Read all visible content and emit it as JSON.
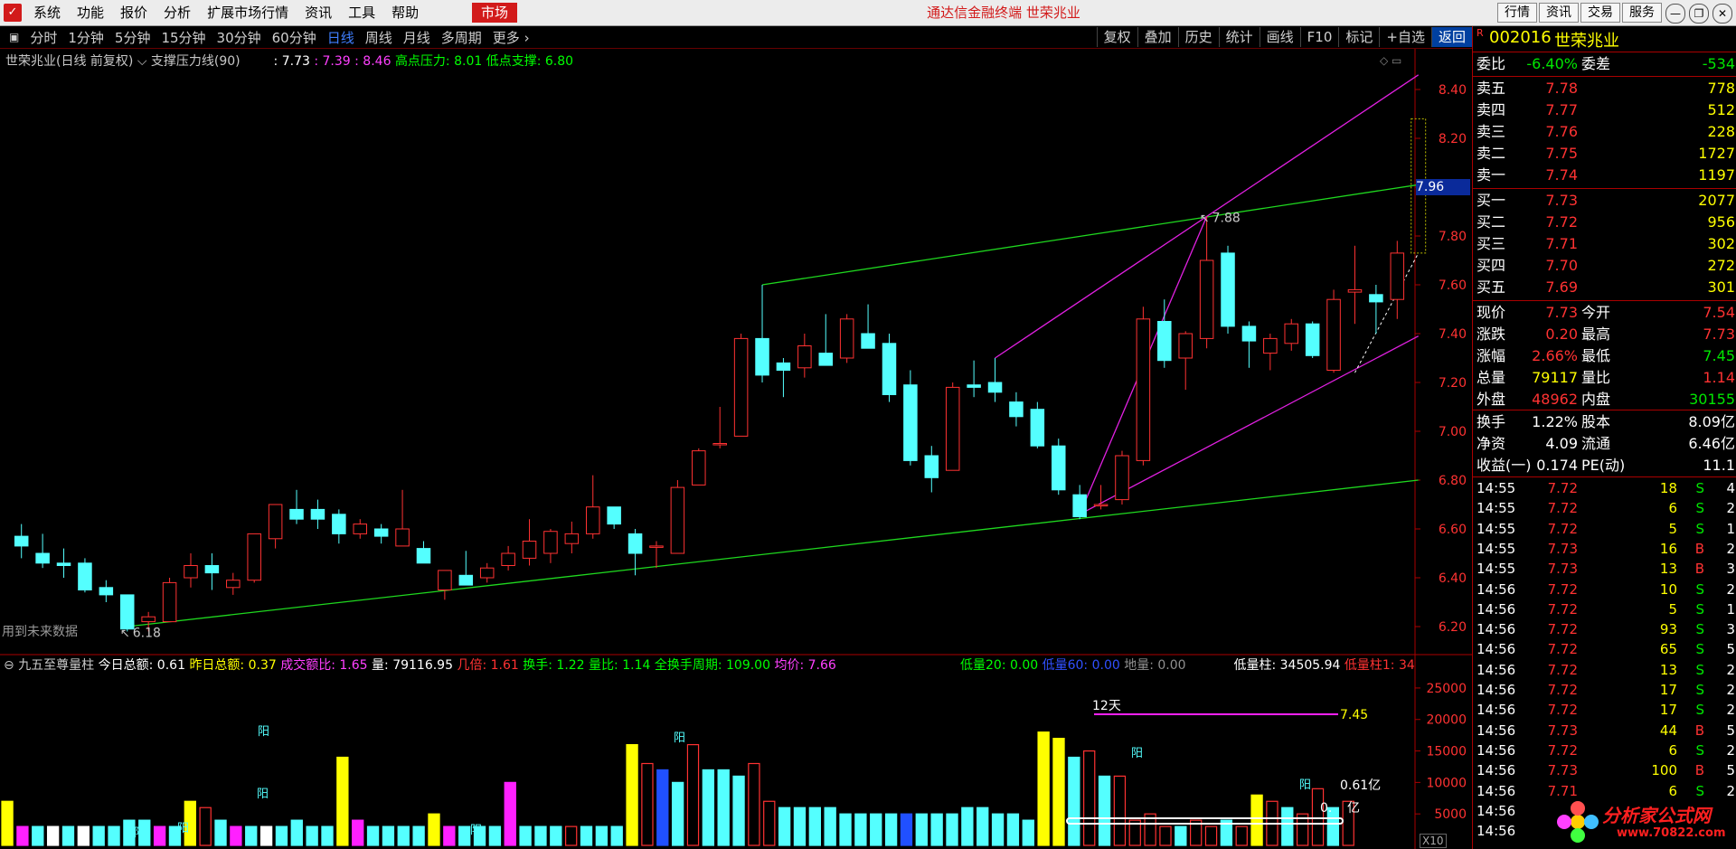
{
  "menubar": {
    "logo": "",
    "items": [
      "系统",
      "功能",
      "报价",
      "分析",
      "扩展市场行情",
      "资讯",
      "工具",
      "帮助"
    ],
    "market": "市场",
    "title": "通达信金融终端  世荣兆业",
    "right_buttons": [
      "行情",
      "资讯",
      "交易",
      "服务"
    ],
    "win_buttons": [
      "—",
      "❐",
      "✕"
    ]
  },
  "toolbar": {
    "periods": [
      "分时",
      "1分钟",
      "5分钟",
      "15分钟",
      "30分钟",
      "60分钟",
      "日线",
      "周线",
      "月线",
      "多周期",
      "更多 ›"
    ],
    "active": "日线",
    "right": [
      "复权",
      "叠加",
      "历史",
      "统计",
      "画线",
      "F10",
      "标记",
      "+自选",
      "返回"
    ]
  },
  "main_chart": {
    "stock_label": "世荣兆业(日线 前复权)",
    "indicator": "支撑压力线(90)",
    "val1": ": 7.73",
    "val2": ": 7.39",
    "val3": ": 8.46",
    "high_label": "高点压力: 8.01",
    "low_label": "低点支撑: 6.80",
    "future_note": "用到未来数据",
    "high_point_label": "7.88",
    "low_point_label": "6.18",
    "current_price_tag": "7.96",
    "y_ticks": [
      "8.40",
      "8.20",
      "8.00",
      "7.80",
      "7.60",
      "7.40",
      "7.20",
      "7.00",
      "6.80",
      "6.60",
      "6.40",
      "6.20"
    ]
  },
  "sub_chart": {
    "name": "九五至尊量柱",
    "today_total": "今日总额: 0.61",
    "yesterday_total": "昨日总额: 0.37",
    "amount_ratio": "成交额比: 1.65",
    "volume": "量: 79116.95",
    "times": "几倍: 1.61",
    "turnover": "换手: 1.22",
    "vol_ratio": "量比: 1.14",
    "full_turnover": "全换手周期: 109.00",
    "avg_price": "均价: 7.66",
    "low20": "低量20: 0.00",
    "low60": "低量60: 0.00",
    "ground": "地量: 0.00",
    "low_col": "低量柱: 34505.94",
    "low_col2": "低量柱1: 34",
    "label_12d": "12天",
    "label_745": "7.45",
    "label_061": "0.61亿",
    "label_037": "0.",
    "label_yi": "亿",
    "yang_labels": [
      "阳",
      "阳",
      "阳",
      "阳",
      "阳",
      "阳",
      "阳",
      "阳",
      "1"
    ],
    "y_ticks": [
      "25000",
      "20000",
      "15000",
      "10000",
      "5000"
    ],
    "unit": "X10"
  },
  "chart_data": {
    "type": "candlestick",
    "candles": [
      {
        "o": 6.57,
        "h": 6.62,
        "l": 6.48,
        "c": 6.53
      },
      {
        "o": 6.5,
        "h": 6.58,
        "l": 6.44,
        "c": 6.46
      },
      {
        "o": 6.46,
        "h": 6.52,
        "l": 6.4,
        "c": 6.45
      },
      {
        "o": 6.46,
        "h": 6.48,
        "l": 6.34,
        "c": 6.35
      },
      {
        "o": 6.36,
        "h": 6.39,
        "l": 6.3,
        "c": 6.33
      },
      {
        "o": 6.33,
        "h": 6.33,
        "l": 6.18,
        "c": 6.19
      },
      {
        "o": 6.22,
        "h": 6.26,
        "l": 6.18,
        "c": 6.24
      },
      {
        "o": 6.22,
        "h": 6.4,
        "l": 6.22,
        "c": 6.38
      },
      {
        "o": 6.4,
        "h": 6.5,
        "l": 6.36,
        "c": 6.45
      },
      {
        "o": 6.45,
        "h": 6.5,
        "l": 6.35,
        "c": 6.42
      },
      {
        "o": 6.36,
        "h": 6.42,
        "l": 6.33,
        "c": 6.39
      },
      {
        "o": 6.39,
        "h": 6.58,
        "l": 6.38,
        "c": 6.58
      },
      {
        "o": 6.56,
        "h": 6.7,
        "l": 6.52,
        "c": 6.7
      },
      {
        "o": 6.68,
        "h": 6.76,
        "l": 6.62,
        "c": 6.64
      },
      {
        "o": 6.68,
        "h": 6.72,
        "l": 6.6,
        "c": 6.64
      },
      {
        "o": 6.66,
        "h": 6.68,
        "l": 6.54,
        "c": 6.58
      },
      {
        "o": 6.58,
        "h": 6.64,
        "l": 6.56,
        "c": 6.62
      },
      {
        "o": 6.6,
        "h": 6.62,
        "l": 6.54,
        "c": 6.57
      },
      {
        "o": 6.53,
        "h": 6.76,
        "l": 6.53,
        "c": 6.6
      },
      {
        "o": 6.52,
        "h": 6.55,
        "l": 6.46,
        "c": 6.46
      },
      {
        "o": 6.35,
        "h": 6.43,
        "l": 6.31,
        "c": 6.43
      },
      {
        "o": 6.41,
        "h": 6.51,
        "l": 6.38,
        "c": 6.37
      },
      {
        "o": 6.4,
        "h": 6.46,
        "l": 6.38,
        "c": 6.44
      },
      {
        "o": 6.45,
        "h": 6.53,
        "l": 6.43,
        "c": 6.5
      },
      {
        "o": 6.48,
        "h": 6.64,
        "l": 6.45,
        "c": 6.55
      },
      {
        "o": 6.5,
        "h": 6.6,
        "l": 6.46,
        "c": 6.59
      },
      {
        "o": 6.54,
        "h": 6.63,
        "l": 6.5,
        "c": 6.58
      },
      {
        "o": 6.58,
        "h": 6.82,
        "l": 6.56,
        "c": 6.69
      },
      {
        "o": 6.69,
        "h": 6.66,
        "l": 6.6,
        "c": 6.62
      },
      {
        "o": 6.58,
        "h": 6.6,
        "l": 6.41,
        "c": 6.5
      },
      {
        "o": 6.53,
        "h": 6.55,
        "l": 6.44,
        "c": 6.53
      },
      {
        "o": 6.5,
        "h": 6.8,
        "l": 6.5,
        "c": 6.77
      },
      {
        "o": 6.78,
        "h": 6.93,
        "l": 6.78,
        "c": 6.92
      },
      {
        "o": 6.95,
        "h": 7.1,
        "l": 6.93,
        "c": 6.95
      },
      {
        "o": 6.98,
        "h": 7.4,
        "l": 6.98,
        "c": 7.38
      },
      {
        "o": 7.38,
        "h": 7.6,
        "l": 7.2,
        "c": 7.23
      },
      {
        "o": 7.28,
        "h": 7.3,
        "l": 7.14,
        "c": 7.25
      },
      {
        "o": 7.26,
        "h": 7.4,
        "l": 7.22,
        "c": 7.35
      },
      {
        "o": 7.32,
        "h": 7.48,
        "l": 7.28,
        "c": 7.27
      },
      {
        "o": 7.3,
        "h": 7.48,
        "l": 7.28,
        "c": 7.46
      },
      {
        "o": 7.4,
        "h": 7.52,
        "l": 7.35,
        "c": 7.34
      },
      {
        "o": 7.36,
        "h": 7.4,
        "l": 7.12,
        "c": 7.15
      },
      {
        "o": 7.19,
        "h": 7.25,
        "l": 6.86,
        "c": 6.88
      },
      {
        "o": 6.9,
        "h": 6.94,
        "l": 6.75,
        "c": 6.81
      },
      {
        "o": 6.84,
        "h": 7.2,
        "l": 6.84,
        "c": 7.18
      },
      {
        "o": 7.19,
        "h": 7.29,
        "l": 7.14,
        "c": 7.18
      },
      {
        "o": 7.2,
        "h": 7.3,
        "l": 7.12,
        "c": 7.16
      },
      {
        "o": 7.12,
        "h": 7.16,
        "l": 7.02,
        "c": 7.06
      },
      {
        "o": 7.09,
        "h": 7.12,
        "l": 6.93,
        "c": 6.94
      },
      {
        "o": 6.94,
        "h": 6.97,
        "l": 6.74,
        "c": 6.76
      },
      {
        "o": 6.74,
        "h": 6.78,
        "l": 6.64,
        "c": 6.65
      },
      {
        "o": 6.7,
        "h": 6.78,
        "l": 6.68,
        "c": 6.7
      },
      {
        "o": 6.72,
        "h": 6.92,
        "l": 6.7,
        "c": 6.9
      },
      {
        "o": 6.88,
        "h": 7.51,
        "l": 6.86,
        "c": 7.46
      },
      {
        "o": 7.45,
        "h": 7.54,
        "l": 7.26,
        "c": 7.29
      },
      {
        "o": 7.3,
        "h": 7.41,
        "l": 7.17,
        "c": 7.4
      },
      {
        "o": 7.38,
        "h": 7.88,
        "l": 7.34,
        "c": 7.7
      },
      {
        "o": 7.73,
        "h": 7.76,
        "l": 7.4,
        "c": 7.43
      },
      {
        "o": 7.43,
        "h": 7.45,
        "l": 7.26,
        "c": 7.37
      },
      {
        "o": 7.32,
        "h": 7.4,
        "l": 7.25,
        "c": 7.38
      },
      {
        "o": 7.36,
        "h": 7.46,
        "l": 7.33,
        "c": 7.44
      },
      {
        "o": 7.44,
        "h": 7.45,
        "l": 7.3,
        "c": 7.31
      },
      {
        "o": 7.25,
        "h": 7.58,
        "l": 7.24,
        "c": 7.54
      },
      {
        "o": 7.57,
        "h": 7.76,
        "l": 7.44,
        "c": 7.58
      },
      {
        "o": 7.56,
        "h": 7.6,
        "l": 7.4,
        "c": 7.53
      },
      {
        "o": 7.54,
        "h": 7.78,
        "l": 7.46,
        "c": 7.73
      }
    ],
    "support_line": {
      "from": [
        6.18,
        6.2
      ],
      "to": [
        8.0,
        6.8
      ]
    },
    "pressure_line": {
      "from": [
        7.35,
        7.6
      ],
      "to": [
        9.0,
        8.01
      ]
    },
    "channel_upper": {
      "from": [
        7.35,
        7.3
      ],
      "to": [
        9.0,
        8.46
      ]
    },
    "channel_lower": {
      "from": [
        7.2,
        6.66
      ],
      "to": [
        9.0,
        7.39
      ]
    },
    "volumes": [
      7,
      3,
      3,
      3,
      3,
      3,
      3,
      3,
      4,
      4,
      3,
      3,
      7,
      6,
      4,
      3,
      3,
      3,
      3,
      4,
      3,
      3,
      14,
      4,
      3,
      3,
      3,
      3,
      5,
      3,
      3,
      3,
      3,
      10,
      3,
      3,
      3,
      3,
      3,
      3,
      3,
      16,
      13,
      12,
      10,
      16,
      12,
      12,
      11,
      13,
      7,
      6,
      6,
      6,
      6,
      5,
      5,
      5,
      5,
      5,
      5,
      5,
      5,
      6,
      6,
      5,
      5,
      4,
      18,
      17,
      14,
      15,
      11,
      11,
      4,
      5,
      3,
      3,
      4,
      3,
      4,
      3,
      8,
      7,
      6,
      5,
      9,
      6,
      7
    ],
    "volume_colors": [
      "y",
      "m",
      "c",
      "w",
      "c",
      "w",
      "c",
      "c",
      "c",
      "c",
      "m",
      "c",
      "y",
      "r",
      "c",
      "m",
      "c",
      "w",
      "c",
      "c",
      "c",
      "c",
      "y",
      "m",
      "c",
      "c",
      "c",
      "c",
      "y",
      "m",
      "c",
      "c",
      "c",
      "m",
      "c",
      "c",
      "c",
      "r",
      "c",
      "c",
      "c",
      "y",
      "r",
      "b",
      "c",
      "r",
      "c",
      "c",
      "c",
      "r",
      "r",
      "c",
      "c",
      "c",
      "c",
      "c",
      "c",
      "c",
      "c",
      "b",
      "c",
      "c",
      "c",
      "c",
      "c",
      "c",
      "c",
      "c",
      "y",
      "y",
      "c",
      "r",
      "c",
      "r",
      "r",
      "r",
      "r",
      "c",
      "r",
      "r",
      "c",
      "r",
      "y",
      "r",
      "c",
      "r",
      "r",
      "c",
      "r"
    ],
    "volume_ylim": [
      0,
      27000
    ]
  },
  "right_panel": {
    "badge": "R",
    "code": "002016",
    "name": "世荣兆业",
    "weibi_label": "委比",
    "weibi_value": "-6.40%",
    "weicha_label": "委差",
    "weicha_value": "-534",
    "asks": [
      {
        "label": "卖五",
        "price": "7.78",
        "vol": "778"
      },
      {
        "label": "卖四",
        "price": "7.77",
        "vol": "512"
      },
      {
        "label": "卖三",
        "price": "7.76",
        "vol": "228"
      },
      {
        "label": "卖二",
        "price": "7.75",
        "vol": "1727"
      },
      {
        "label": "卖一",
        "price": "7.74",
        "vol": "1197"
      }
    ],
    "bids": [
      {
        "label": "买一",
        "price": "7.73",
        "vol": "2077"
      },
      {
        "label": "买二",
        "price": "7.72",
        "vol": "956"
      },
      {
        "label": "买三",
        "price": "7.71",
        "vol": "302"
      },
      {
        "label": "买四",
        "price": "7.70",
        "vol": "272"
      },
      {
        "label": "买五",
        "price": "7.69",
        "vol": "301"
      }
    ],
    "stats": [
      {
        "l1": "现价",
        "v1": "7.73",
        "l2": "今开",
        "v2": "7.54",
        "c1": "red",
        "c2": "red"
      },
      {
        "l1": "涨跌",
        "v1": "0.20",
        "l2": "最高",
        "v2": "7.73",
        "c1": "red",
        "c2": "red"
      },
      {
        "l1": "涨幅",
        "v1": "2.66%",
        "l2": "最低",
        "v2": "7.45",
        "c1": "red",
        "c2": "green"
      },
      {
        "l1": "总量",
        "v1": "79117",
        "l2": "量比",
        "v2": "1.14",
        "c1": "yellow",
        "c2": "red"
      },
      {
        "l1": "外盘",
        "v1": "48962",
        "l2": "内盘",
        "v2": "30155",
        "c1": "red",
        "c2": "green"
      }
    ],
    "finance": [
      {
        "l1": "换手",
        "v1": "1.22%",
        "l2": "股本",
        "v2": "8.09亿"
      },
      {
        "l1": "净资",
        "v1": "4.09",
        "l2": "流通",
        "v2": "6.46亿"
      },
      {
        "l1": "收益(一)",
        "v1": "0.174",
        "l2": "PE(动)",
        "v2": "11.1"
      }
    ],
    "ticks": [
      {
        "t": "14:55",
        "p": "7.72",
        "v": "18",
        "s": "S",
        "n": "4"
      },
      {
        "t": "14:55",
        "p": "7.72",
        "v": "6",
        "s": "S",
        "n": "2"
      },
      {
        "t": "14:55",
        "p": "7.72",
        "v": "5",
        "s": "S",
        "n": "1"
      },
      {
        "t": "14:55",
        "p": "7.73",
        "v": "16",
        "s": "B",
        "n": "2"
      },
      {
        "t": "14:55",
        "p": "7.73",
        "v": "13",
        "s": "B",
        "n": "3"
      },
      {
        "t": "14:56",
        "p": "7.72",
        "v": "10",
        "s": "S",
        "n": "2"
      },
      {
        "t": "14:56",
        "p": "7.72",
        "v": "5",
        "s": "S",
        "n": "1"
      },
      {
        "t": "14:56",
        "p": "7.72",
        "v": "93",
        "s": "S",
        "n": "3"
      },
      {
        "t": "14:56",
        "p": "7.72",
        "v": "65",
        "s": "S",
        "n": "5"
      },
      {
        "t": "14:56",
        "p": "7.72",
        "v": "13",
        "s": "S",
        "n": "2"
      },
      {
        "t": "14:56",
        "p": "7.72",
        "v": "17",
        "s": "S",
        "n": "2"
      },
      {
        "t": "14:56",
        "p": "7.72",
        "v": "17",
        "s": "S",
        "n": "2"
      },
      {
        "t": "14:56",
        "p": "7.73",
        "v": "44",
        "s": "B",
        "n": "5"
      },
      {
        "t": "14:56",
        "p": "7.72",
        "v": "6",
        "s": "S",
        "n": "2"
      },
      {
        "t": "14:56",
        "p": "7.73",
        "v": "100",
        "s": "B",
        "n": "5"
      },
      {
        "t": "14:56",
        "p": "7.71",
        "v": "6",
        "s": "S",
        "n": "2"
      },
      {
        "t": "14:56",
        "p": "",
        "v": "",
        "s": "",
        "n": ""
      },
      {
        "t": "14:56",
        "p": "",
        "v": "",
        "s": "",
        "n": ""
      }
    ]
  },
  "watermark": {
    "text": "分析家公式网",
    "url": "www.70822.com"
  }
}
